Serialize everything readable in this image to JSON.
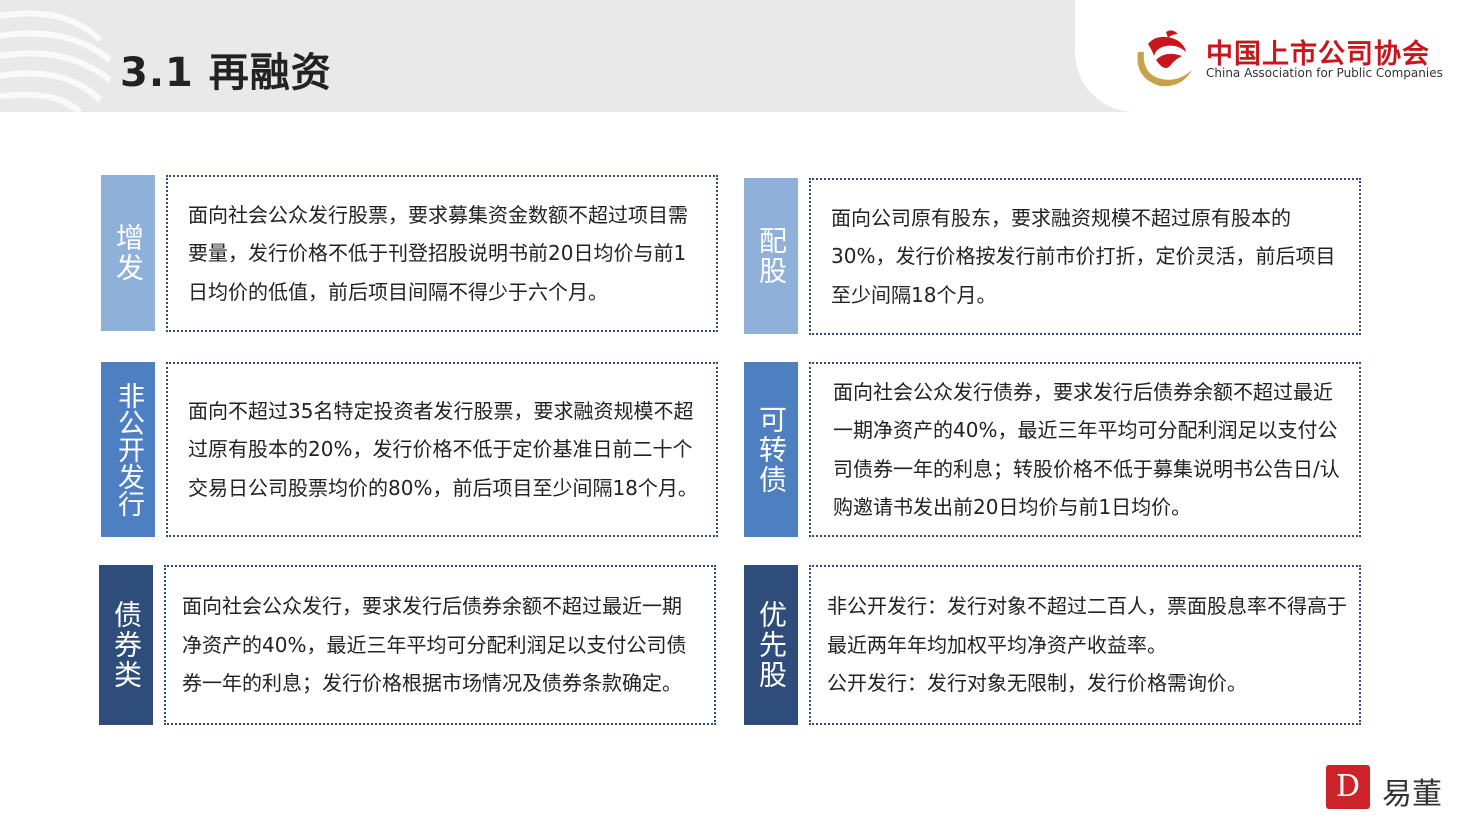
{
  "slide": {
    "title": "3.1 再融资"
  },
  "logo": {
    "name_cn": "中国上市公司协会",
    "name_en": "China Association for Public Companies"
  },
  "cards": [
    {
      "tag": "增发",
      "text": "面向社会公众发行股票，要求募集资金数额不超过项目需要量，发行价格不低于刊登招股说明书前20日均价与前1日均价的低值，前后项目间隔不得少于六个月。",
      "color": "#8fb0d9"
    },
    {
      "tag": "配股",
      "text": "面向公司原有股东，要求融资规模不超过原有股本的30%，发行价格按发行前市价打折，定价灵活，前后项目至少间隔18个月。",
      "color": "#8fb0d9"
    },
    {
      "tag": "非公开发行",
      "text": "面向不超过35名特定投资者发行股票，要求融资规模不超过原有股本的20%，发行价格不低于定价基准日前二十个交易日公司股票均价的80%，前后项目至少间隔18个月。",
      "color": "#4e7fc0"
    },
    {
      "tag": "可转债",
      "text": "面向社会公众发行债券，要求发行后债券余额不超过最近一期净资产的40%，最近三年平均可分配利润足以支付公司债券一年的利息；转股价格不低于募集说明书公告日/认购邀请书发出前20日均价与前1日均价。",
      "color": "#4e7fc0"
    },
    {
      "tag": "债券类",
      "text": "面向社会公众发行，要求发行后债券余额不超过最近一期净资产的40%，最近三年平均可分配利润足以支付公司债券一年的利息；发行价格根据市场情况及债券条款确定。",
      "color": "#2e4d7b"
    },
    {
      "tag": "优先股",
      "text_lines": [
        "非公开发行：发行对象不超过二百人，票面股息率不得高于最近两年年均加权平均净资产收益率。",
        "公开发行：发行对象无限制，发行价格需询价。"
      ],
      "color": "#2e4d7b"
    }
  ],
  "brand": {
    "mark": "D",
    "name": "易董"
  }
}
